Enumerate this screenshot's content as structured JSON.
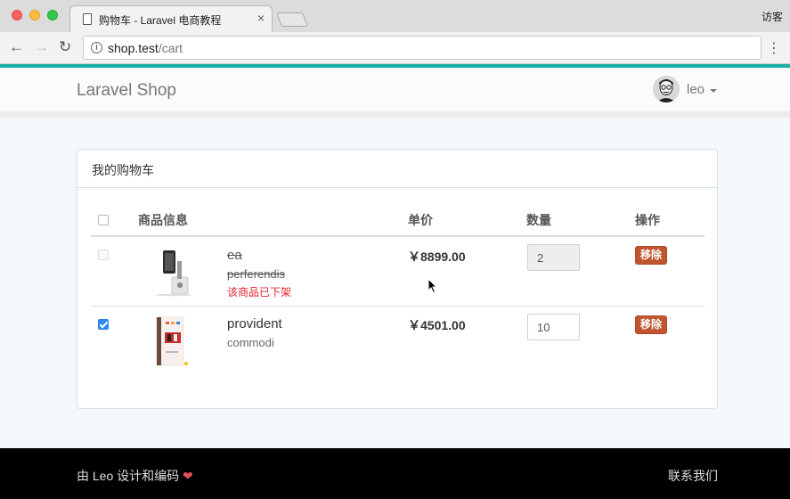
{
  "browser": {
    "tab_title": "购物车 - Laravel 电商教程",
    "tab_close": "×",
    "guest_label": "访客",
    "url_host": "shop.test",
    "url_path": "/cart",
    "info_icon": "i",
    "back_icon": "←",
    "forward_icon": "→",
    "reload_icon": "↻",
    "menu_icon": "⋮"
  },
  "navbar": {
    "brand": "Laravel Shop",
    "user_name": "leo"
  },
  "cart": {
    "panel_title": "我的购物车",
    "columns": {
      "product": "商品信息",
      "price": "单价",
      "quantity": "数量",
      "action": "操作"
    },
    "items": [
      {
        "title": "ea",
        "sku": "perferendis",
        "warning": "该商品已下架",
        "price": "￥8899.00",
        "quantity": "2",
        "remove_label": "移除",
        "selected": false,
        "on_sale": false
      },
      {
        "title": "provident",
        "sku": "commodi",
        "price": "￥4501.00",
        "quantity": "10",
        "remove_label": "移除",
        "selected": true,
        "on_sale": true
      }
    ]
  },
  "footer": {
    "credit": "由 Leo 设计和编码",
    "heart": "❤",
    "contact": "联系我们"
  },
  "colors": {
    "accent_strip": "#1ab1a8",
    "remove_button": "#c0562f",
    "warning_text": "#e4202e",
    "checkbox_checked": "#2f8bf5"
  }
}
